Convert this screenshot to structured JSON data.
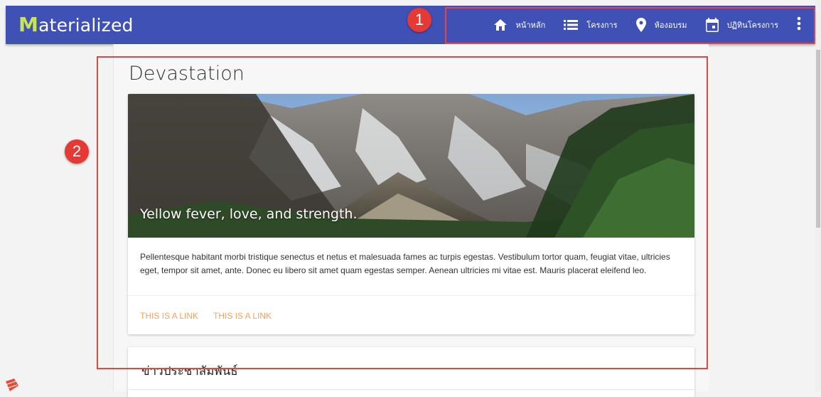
{
  "app": {
    "logo_first": "M",
    "logo_rest": "aterialized"
  },
  "nav": {
    "items": [
      {
        "label": "หน้าหลัก",
        "icon": "home-icon"
      },
      {
        "label": "โครงการ",
        "icon": "list-icon"
      },
      {
        "label": "ห้องอบรม",
        "icon": "map-pin-icon"
      },
      {
        "label": "ปฏิทินโครงการ",
        "icon": "calendar-icon"
      }
    ],
    "more_icon": "more-vert-icon"
  },
  "annotations": {
    "callout1": "1",
    "callout2": "2"
  },
  "page": {
    "title": "Devastation"
  },
  "card": {
    "caption": "Yellow fever, love, and strength.",
    "text": "Pellentesque habitant morbi tristique senectus et netus et malesuada fames ac turpis egestas. Vestibulum tortor quam, feugiat vitae, ultricies eget, tempor sit amet, ante. Donec eu libero sit amet quam egestas semper. Aenean ultricies mi vitae est. Mauris placerat eleifend leo.",
    "links": [
      "THIS IS A LINK",
      "THIS IS A LINK"
    ]
  },
  "card2": {
    "title": "ข่าวประชาสัมพันธ์"
  },
  "colors": {
    "appbar": "#3f51b5",
    "accent_logo": "#c6e35a",
    "link": "#f4a261",
    "callout": "#e53935",
    "highlight": "#e04848"
  }
}
